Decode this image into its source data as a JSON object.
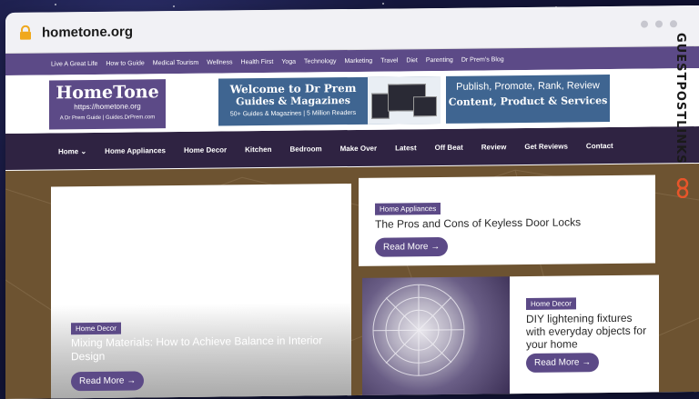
{
  "browser": {
    "url": "hometone.org"
  },
  "top_nav": [
    "Live A Great Life",
    "How to Guide",
    "Medical Tourism",
    "Wellness",
    "Health First",
    "Yoga",
    "Technology",
    "Marketing",
    "Travel",
    "Diet",
    "Parenting",
    "Dr Prem's Blog"
  ],
  "logo": {
    "title": "HomeTone",
    "url": "https://hometone.org",
    "tagline": "A Dr Prem Guide | Guides.DrPrem.com"
  },
  "ad1": {
    "line1": "Welcome to Dr Prem",
    "line2": "Guides & Magazines",
    "line3": "50+ Guides & Magazines | 5 Million Readers"
  },
  "ad2": {
    "line1": "Publish, Promote, Rank, Review",
    "line2": "Content, Product & Services"
  },
  "main_nav": [
    "Home",
    "Home Appliances",
    "Home Decor",
    "Kitchen",
    "Bedroom",
    "Make Over",
    "Latest",
    "Off Beat",
    "Review",
    "Get Reviews",
    "Contact"
  ],
  "cards": {
    "left": {
      "tag": "Home Decor",
      "title": "Mixing Materials: How to Achieve Balance in Interior Design",
      "button": "Read More →"
    },
    "right_top": {
      "tag": "Home Appliances",
      "title": "The Pros and Cons of Keyless Door Locks",
      "button": "Read More →"
    },
    "right_bottom": {
      "tag": "Home Decor",
      "title": "DIY lightening fixtures with everyday objects for your home",
      "button": "Read More →"
    }
  },
  "side_watermark": "GUESTPOSTLINKS",
  "colors": {
    "brand_purple": "#5c4a87",
    "nav_dark": "#2f2342",
    "content_bg": "#6d5331",
    "ad_blue": "#3f6591",
    "link_orange": "#e8552a"
  }
}
